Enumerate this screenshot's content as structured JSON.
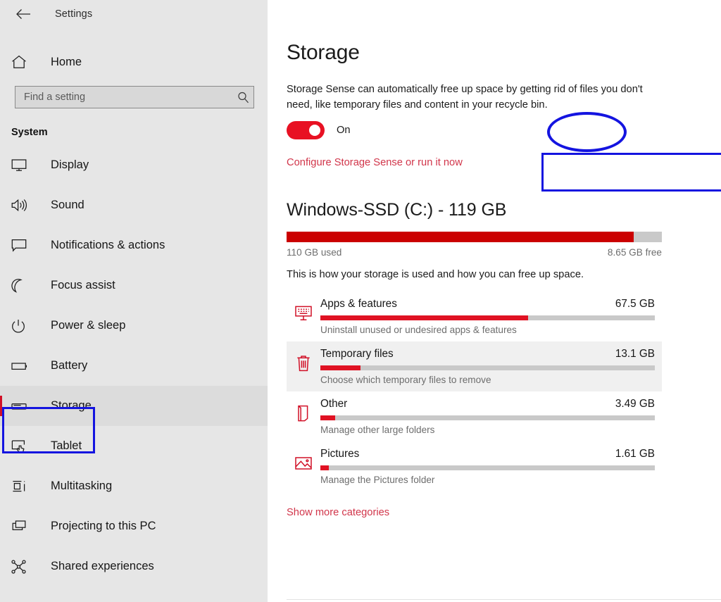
{
  "window": {
    "titlebar_label": "Settings",
    "back_icon": "back-arrow-icon"
  },
  "sidebar": {
    "home": {
      "label": "Home",
      "icon": "home-icon"
    },
    "search": {
      "placeholder": "Find a setting",
      "value": "",
      "icon": "search-icon"
    },
    "group_header": "System",
    "items": [
      {
        "label": "Display",
        "icon": "monitor-icon",
        "selected": false
      },
      {
        "label": "Sound",
        "icon": "speaker-icon",
        "selected": false
      },
      {
        "label": "Notifications & actions",
        "icon": "chat-bubble-icon",
        "selected": false
      },
      {
        "label": "Focus assist",
        "icon": "moon-icon",
        "selected": false
      },
      {
        "label": "Power & sleep",
        "icon": "power-icon",
        "selected": false
      },
      {
        "label": "Battery",
        "icon": "battery-icon",
        "selected": false
      },
      {
        "label": "Storage",
        "icon": "drive-icon",
        "selected": true
      },
      {
        "label": "Tablet",
        "icon": "tablet-touch-icon",
        "selected": false
      },
      {
        "label": "Multitasking",
        "icon": "multitasking-icon",
        "selected": false
      },
      {
        "label": "Projecting to this PC",
        "icon": "project-screen-icon",
        "selected": false
      },
      {
        "label": "Shared experiences",
        "icon": "share-nodes-icon",
        "selected": false
      }
    ]
  },
  "main": {
    "page_title": "Storage",
    "storage_sense": {
      "description": "Storage Sense can automatically free up space by getting rid of files you don't need, like temporary files and content in your recycle bin.",
      "toggle_state": "On",
      "toggle_on": true,
      "configure_link": "Configure Storage Sense or run it now"
    },
    "drive": {
      "title": "Windows-SSD (C:) - 119 GB",
      "used_label": "110 GB used",
      "free_label": "8.65 GB free",
      "used_percent": 92.5,
      "usage_description": "This is how your storage is used and how you can free up space."
    },
    "categories": [
      {
        "name": "Apps & features",
        "size": "67.5 GB",
        "percent": 62,
        "subtitle": "Uninstall unused or undesired apps & features",
        "icon": "apps-features-icon",
        "hovered": false
      },
      {
        "name": "Temporary files",
        "size": "13.1 GB",
        "percent": 12,
        "subtitle": "Choose which temporary files to remove",
        "icon": "trash-icon",
        "hovered": true
      },
      {
        "name": "Other",
        "size": "3.49 GB",
        "percent": 4.5,
        "subtitle": "Manage other large folders",
        "icon": "folder-page-icon",
        "hovered": false
      },
      {
        "name": "Pictures",
        "size": "1.61 GB",
        "percent": 2.5,
        "subtitle": "Manage the Pictures folder",
        "icon": "picture-icon",
        "hovered": false
      }
    ],
    "show_more_label": "Show more categories"
  },
  "annotations": {
    "rect_color": "#1414E0",
    "items": [
      {
        "name": "annotation-storage-nav",
        "shape": "rect"
      },
      {
        "name": "annotation-toggle",
        "shape": "ellipse"
      },
      {
        "name": "annotation-configure-link",
        "shape": "rect"
      }
    ]
  },
  "colors": {
    "accent_red": "#E81123",
    "bar_red": "#CB0000",
    "link_red": "#D1354A",
    "sidebar_bg": "#E6E6E6",
    "annotation_blue": "#1414E0"
  }
}
